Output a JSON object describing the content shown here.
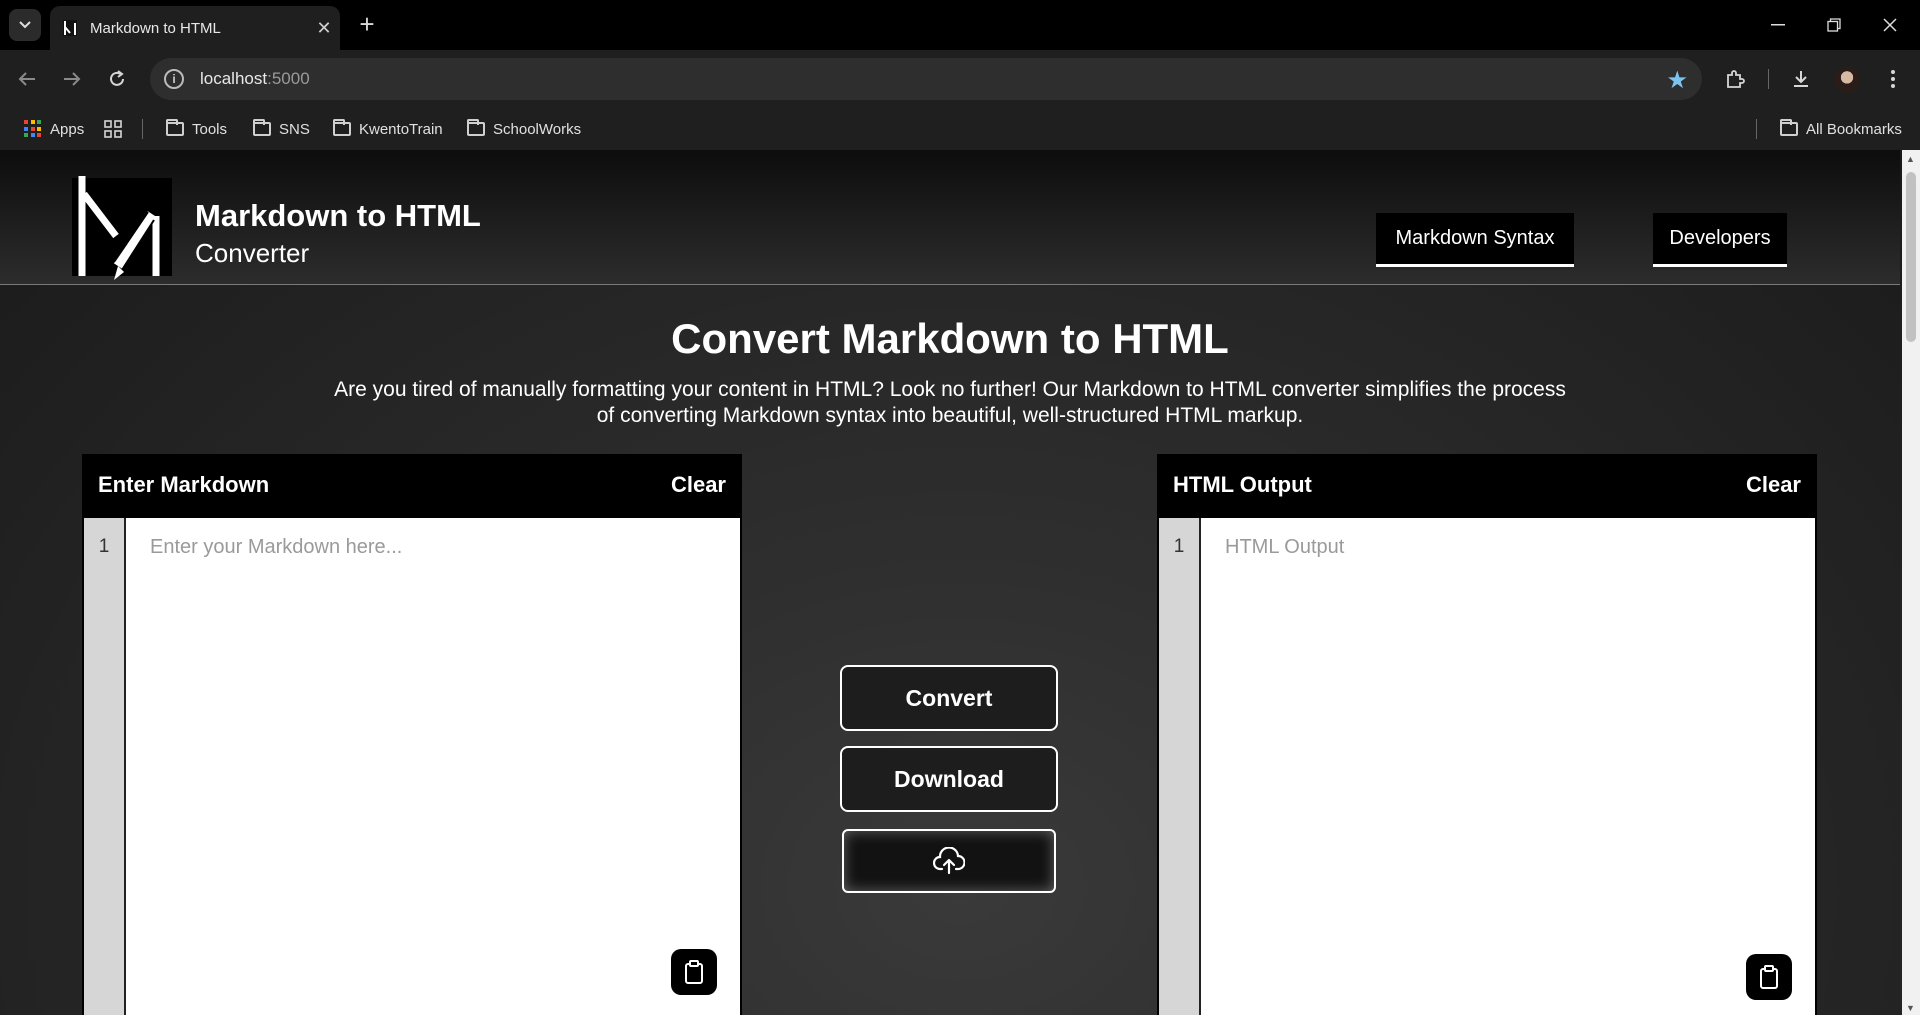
{
  "browser": {
    "tab_title": "Markdown to HTML",
    "tab_close": "✕",
    "new_tab": "+",
    "url_host": "localhost",
    "url_port": ":5000",
    "bookmarks": [
      {
        "label": "Apps"
      },
      {
        "label": "Tools"
      },
      {
        "label": "SNS"
      },
      {
        "label": "KwentoTrain"
      },
      {
        "label": "SchoolWorks"
      }
    ],
    "all_bookmarks": "All Bookmarks"
  },
  "header": {
    "title": "Markdown to HTML",
    "subtitle": "Converter",
    "nav": [
      "Markdown Syntax",
      "Developers"
    ]
  },
  "hero": {
    "title": "Convert Markdown to HTML",
    "description": "Are you tired of manually formatting your content in HTML? Look no further! Our Markdown to HTML converter simplifies the process of converting Markdown syntax into beautiful, well-structured HTML markup."
  },
  "input_panel": {
    "title": "Enter Markdown",
    "clear": "Clear",
    "line_number": "1",
    "placeholder": "Enter your Markdown here..."
  },
  "output_panel": {
    "title": "HTML Output",
    "clear": "Clear",
    "line_number": "1",
    "placeholder": "HTML Output"
  },
  "actions": {
    "convert": "Convert",
    "download": "Download",
    "upload_icon": "cloud-upload-icon"
  }
}
